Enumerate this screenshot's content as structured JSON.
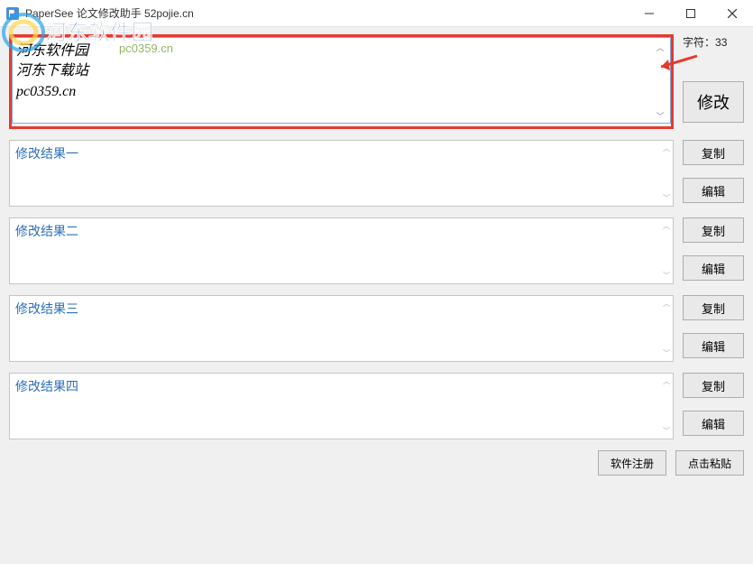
{
  "titlebar": {
    "title": "PaperSee 论文修改助手 52pojie.cn"
  },
  "watermark": {
    "text": "河东软件园",
    "url": "pc0359.cn"
  },
  "input": {
    "text": "河东软件园\n河东下载站\npc0359.cn",
    "char_label": "字符：",
    "char_count": "33"
  },
  "buttons": {
    "modify": "修改",
    "copy": "复制",
    "edit": "编辑",
    "register": "软件注册",
    "paste": "点击粘贴"
  },
  "results": [
    {
      "title": "修改结果一"
    },
    {
      "title": "修改结果二"
    },
    {
      "title": "修改结果三"
    },
    {
      "title": "修改结果四"
    }
  ]
}
